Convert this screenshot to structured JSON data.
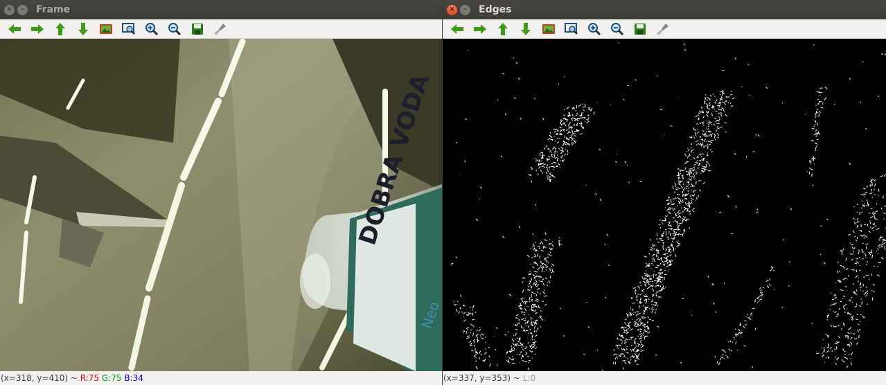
{
  "windows": [
    {
      "title": "Frame",
      "active": false,
      "status": {
        "coords": "(x=318, y=410) ~ ",
        "r": "R:75",
        "g": "G:75",
        "b": "B:34"
      }
    },
    {
      "title": "Edges",
      "active": true,
      "status": {
        "coords": "(x=337, y=353) ~ ",
        "l": "L:0"
      }
    }
  ],
  "toolbar_icons": [
    "arrow-left-icon",
    "arrow-right-icon",
    "arrow-up-icon",
    "arrow-down-icon",
    "image-icon",
    "zoom-region-icon",
    "zoom-in-icon",
    "zoom-out-icon",
    "save-icon",
    "properties-icon"
  ],
  "bottle_label": {
    "brand": "DOBRA VODA",
    "sub": "Neo"
  },
  "colors": {
    "title_bg": "#3c3b37",
    "toolbar_bg": "#f2f1f0",
    "arrow_green": "#3f9a1c",
    "close_orange": "#e95420"
  }
}
